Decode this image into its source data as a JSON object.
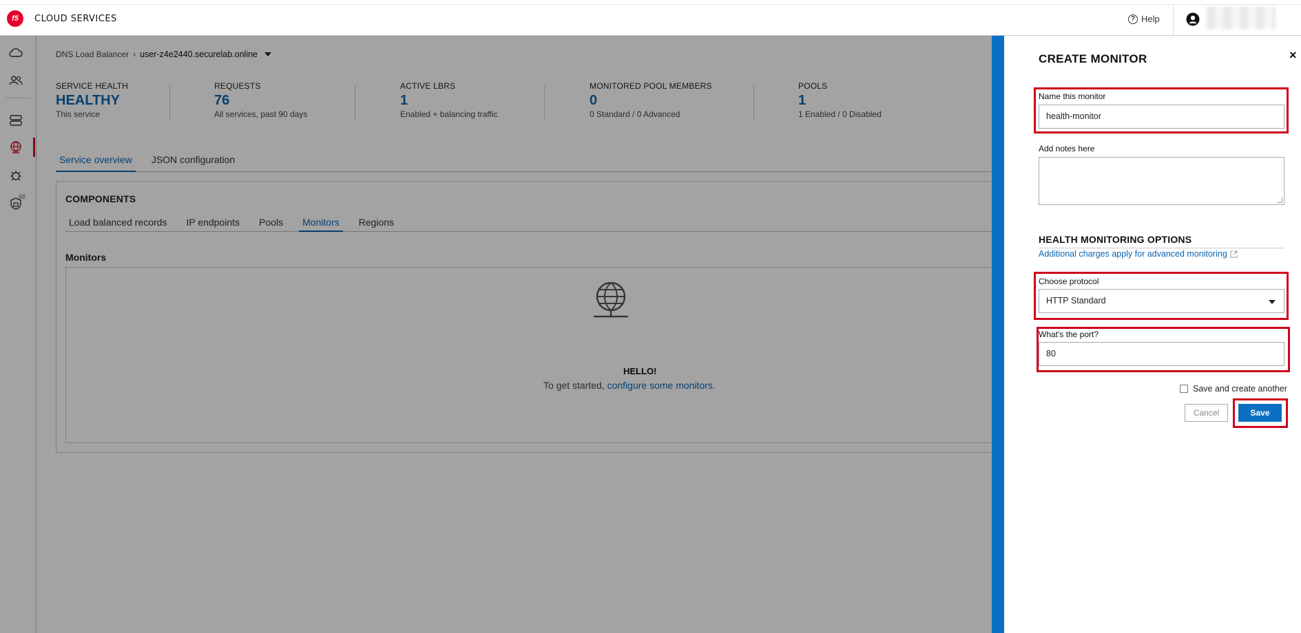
{
  "header": {
    "logo_text": "f5",
    "brand": "CLOUD SERVICES",
    "help_label": "Help"
  },
  "breadcrumb": {
    "root": "DNS Load Balancer",
    "current": "user-z4e2440.securelab.online"
  },
  "stats": [
    {
      "label": "SERVICE HEALTH",
      "value": "HEALTHY",
      "sub": "This service"
    },
    {
      "label": "REQUESTS",
      "value": "76",
      "sub": "All services, past 90 days"
    },
    {
      "label": "ACTIVE LBRS",
      "value": "1",
      "sub": "Enabled + balancing traffic"
    },
    {
      "label": "MONITORED POOL MEMBERS",
      "value": "0",
      "sub": "0 Standard / 0 Advanced"
    },
    {
      "label": "POOLS",
      "value": "1",
      "sub": "1 Enabled / 0 Disabled"
    }
  ],
  "main_tabs": [
    "Service overview",
    "JSON configuration"
  ],
  "components": {
    "title": "COMPONENTS",
    "tabs": [
      "Load balanced records",
      "IP endpoints",
      "Pools",
      "Monitors",
      "Regions"
    ],
    "active_tab": "Monitors",
    "section_title": "Monitors",
    "empty_title": "HELLO!",
    "empty_text": "To get started,",
    "empty_link": "configure some monitors."
  },
  "rail": {
    "badge": "0"
  },
  "drawer": {
    "title": "CREATE MONITOR",
    "close": "×",
    "name_label": "Name this monitor",
    "name_value": "health-monitor",
    "notes_label": "Add notes here",
    "section": "HEALTH MONITORING OPTIONS",
    "charges_link": "Additional charges apply for advanced monitoring",
    "protocol_label": "Choose protocol",
    "protocol_value": "HTTP Standard",
    "port_label": "What's the port?",
    "port_value": "80",
    "save_another": "Save and create another",
    "cancel": "Cancel",
    "save": "Save"
  },
  "colors": {
    "accent": "#0b65b0",
    "brand_red": "#e4002b",
    "highlight": "#d0021b",
    "drawer_bar": "#0b70c2"
  }
}
